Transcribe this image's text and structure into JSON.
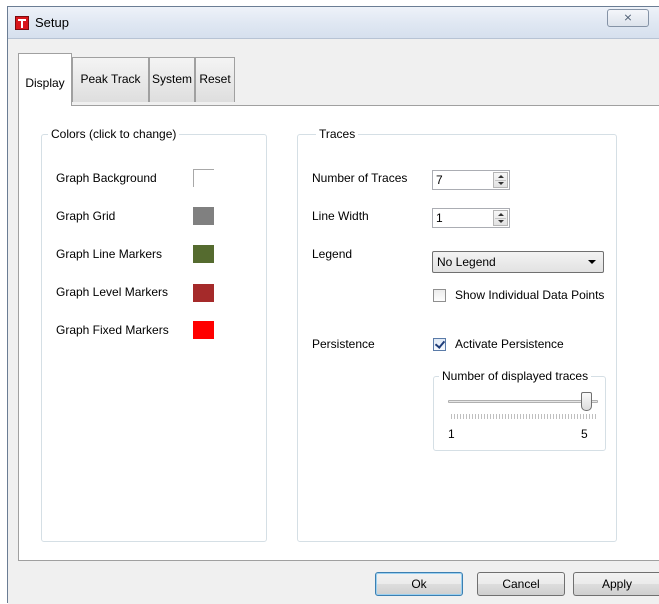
{
  "window": {
    "title": "Setup",
    "close_label": "⨯"
  },
  "tabs": [
    {
      "label": "Display",
      "active": true
    },
    {
      "label": "Peak Track",
      "active": false
    },
    {
      "label": "System",
      "active": false
    },
    {
      "label": "Reset",
      "active": false
    }
  ],
  "colors_group": {
    "title": "Colors (click to change)",
    "items": [
      {
        "label": "Graph Background",
        "color": "#ffffff"
      },
      {
        "label": "Graph Grid",
        "color": "#808080"
      },
      {
        "label": "Graph Line Markers",
        "color": "#556b2f"
      },
      {
        "label": "Graph Level Markers",
        "color": "#a52a2a"
      },
      {
        "label": "Graph Fixed Markers",
        "color": "#ff0000"
      }
    ]
  },
  "traces_group": {
    "title": "Traces",
    "number_of_traces": {
      "label": "Number of Traces",
      "value": "7"
    },
    "line_width": {
      "label": "Line Width",
      "value": "1"
    },
    "legend": {
      "label": "Legend",
      "value": "No Legend"
    },
    "show_points": {
      "label": "Show Individual Data Points",
      "checked": false
    },
    "persistence": {
      "label": "Persistence",
      "checkbox_label": "Activate Persistence",
      "checked": true
    },
    "displayed_traces": {
      "title": "Number of displayed traces",
      "min_label": "1",
      "max_label": "5",
      "value": 5
    }
  },
  "buttons": {
    "ok": "Ok",
    "cancel": "Cancel",
    "apply": "Apply"
  }
}
